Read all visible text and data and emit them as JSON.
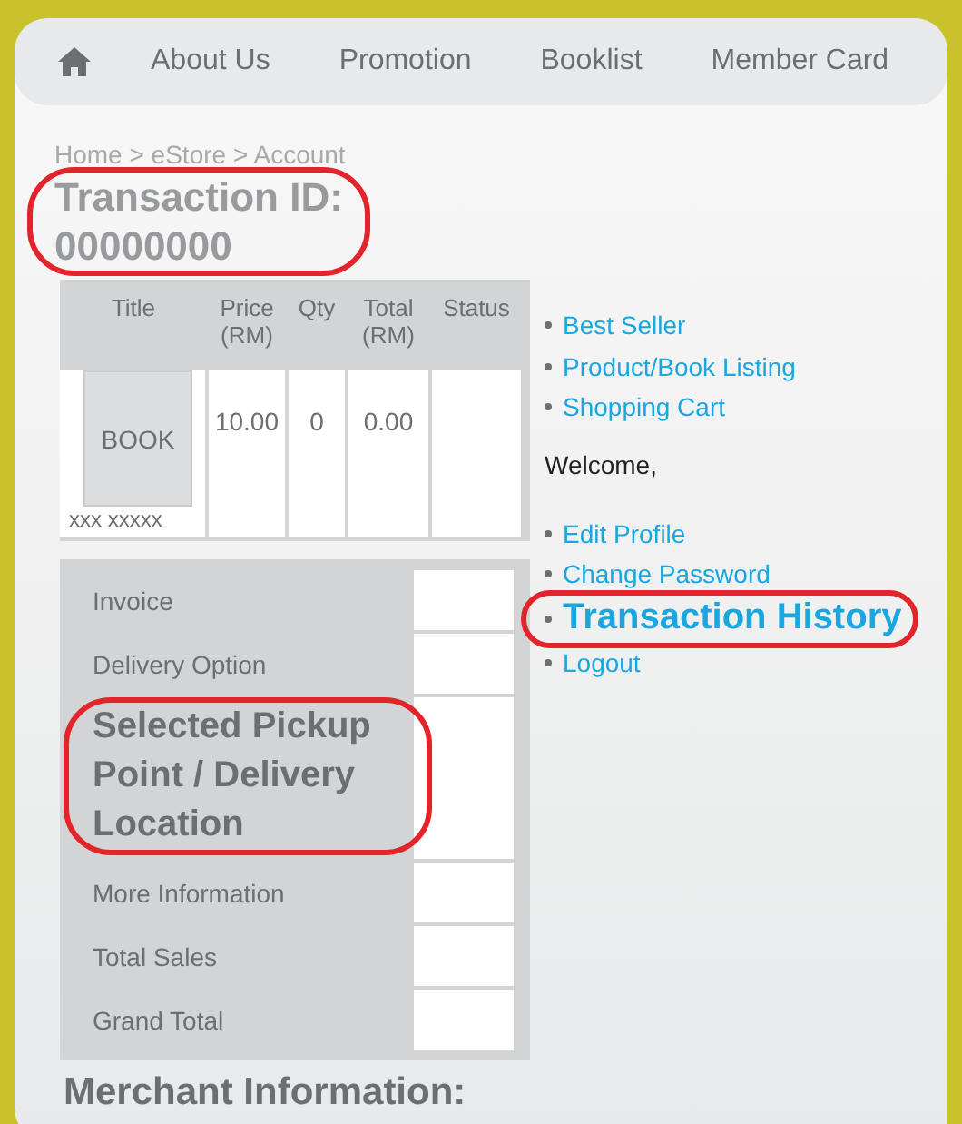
{
  "nav": {
    "links": [
      "About Us",
      "Promotion",
      "Booklist",
      "Member Card"
    ]
  },
  "breadcrumb": "Home > eStore > Account",
  "title": {
    "lines": [
      "Transaction ID:",
      "00000000"
    ],
    "highlighted": true
  },
  "order_table": {
    "columns": [
      [
        "Title"
      ],
      [
        "Price",
        "(RM)"
      ],
      [
        "Qty"
      ],
      [
        "Total",
        "(RM)"
      ],
      [
        "Status"
      ]
    ],
    "rows": [
      {
        "cover": "BOOK",
        "title": "xxx xxxxx",
        "price": "10.00",
        "qty": "0",
        "total": "0.00"
      }
    ]
  },
  "summary": [
    {
      "label": "Invoice",
      "highlighted": false
    },
    {
      "label": "Delivery Option",
      "highlighted": false
    },
    {
      "label": "Selected Pickup Point / Delivery Location",
      "highlighted": true
    },
    {
      "label": "More Information",
      "highlighted": false
    },
    {
      "label": "Total Sales",
      "highlighted": false
    },
    {
      "label": "Grand Total",
      "highlighted": false
    }
  ],
  "shop_links": [
    "Best Seller",
    "Product/Book Listing",
    "Shopping Cart"
  ],
  "welcome": "Welcome,",
  "account_links": [
    {
      "label": "Edit Profile",
      "highlighted": false
    },
    {
      "label": "Change Password",
      "highlighted": false
    },
    {
      "label": "Transaction History",
      "highlighted": true
    },
    {
      "label": "Logout",
      "highlighted": false
    }
  ],
  "merchant_heading": "Merchant Information:"
}
